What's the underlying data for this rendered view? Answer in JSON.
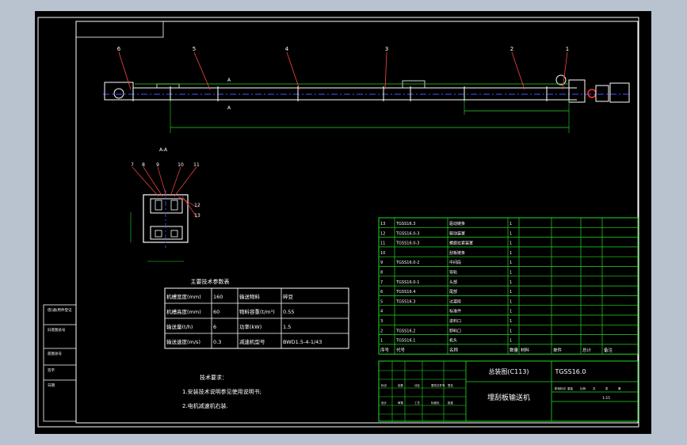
{
  "colors": {
    "background": "#000000",
    "frame": "#ffffff",
    "table_lines": "#22dd22",
    "dimensions": "#22dd22",
    "leaders": "#ff4444",
    "centerline": "#4455ff",
    "text": "#ffffff",
    "outer": "#b9c3cf"
  },
  "drawing": {
    "balloons_main": [
      "6",
      "5",
      "4",
      "3",
      "2",
      "1"
    ],
    "section_marker": "A",
    "section_title": "A-A",
    "balloons_section": [
      "7",
      "8",
      "9",
      "10",
      "11",
      "12",
      "13"
    ]
  },
  "params_table": {
    "title": "主要技术参数表",
    "rows": [
      [
        "机槽宽度(mm)",
        "160",
        "输送物料",
        "碎豆"
      ],
      [
        "机槽高度(mm)",
        "60",
        "物料容重(t/m³)",
        "0.55"
      ],
      [
        "输送量(t/h)",
        "6",
        "功率(kW)",
        "1.5"
      ],
      [
        "输送速度(m/s)",
        "0.3",
        "减速机型号",
        "BWD1.5-4-1/43"
      ]
    ]
  },
  "tech_req": {
    "title": "技术要求：",
    "items": [
      "1.安装技术说明参见使用说明书;",
      "2.电机减速机右装."
    ]
  },
  "bom": {
    "header": [
      "序号",
      "代号",
      "名称",
      "数量",
      "材料",
      "单件",
      "总计",
      "备注"
    ],
    "rows": [
      [
        "13",
        "TGSS16.3",
        "驱动链条",
        "1",
        "",
        "",
        "",
        ""
      ],
      [
        "12",
        "TGSS16.0-3",
        "驱动装置",
        "1",
        "",
        "",
        "",
        ""
      ],
      [
        "11",
        "TGSS16.0-3",
        "螺旋拉紧装置",
        "1",
        "",
        "",
        "",
        ""
      ],
      [
        "10",
        "",
        "刮板链条",
        "1",
        "",
        "",
        "",
        ""
      ],
      [
        "9",
        "TGSS16.0-2",
        "中间段",
        "1",
        "",
        "",
        "",
        ""
      ],
      [
        "8",
        "",
        "导轨",
        "1",
        "",
        "",
        "",
        ""
      ],
      [
        "7",
        "TGSS16.0-1",
        "头部",
        "1",
        "",
        "",
        "",
        ""
      ],
      [
        "6",
        "TGSS16.4",
        "尾部",
        "1",
        "",
        "",
        "",
        ""
      ],
      [
        "5",
        "TGSS16.3",
        "过渡段",
        "1",
        "",
        "",
        "",
        ""
      ],
      [
        "4",
        "",
        "标准件",
        "1",
        "",
        "",
        "",
        ""
      ],
      [
        "3",
        "",
        "进料口",
        "1",
        "",
        "",
        "",
        ""
      ],
      [
        "2",
        "TGSS16.2",
        "卸料口",
        "1",
        "",
        "",
        "",
        ""
      ],
      [
        "1",
        "TGSS16.1",
        "机头",
        "1",
        "",
        "",
        "",
        ""
      ]
    ]
  },
  "title_block": {
    "drawing_name": "总装图(C113)",
    "drawing_no": "TGSS16.0",
    "product_name": "埋刮板输送机",
    "labels": [
      "标记",
      "处数",
      "分区",
      "更改文件号",
      "签名",
      "设计",
      "审核",
      "工艺",
      "标准化",
      "批准",
      "阶段标记",
      "重量",
      "比例",
      "共",
      "张",
      "第"
    ],
    "scale": "1:15"
  },
  "left_strip": [
    "借(通)用件登记",
    "旧底图总号",
    "底图总号",
    "签字",
    "日期"
  ]
}
